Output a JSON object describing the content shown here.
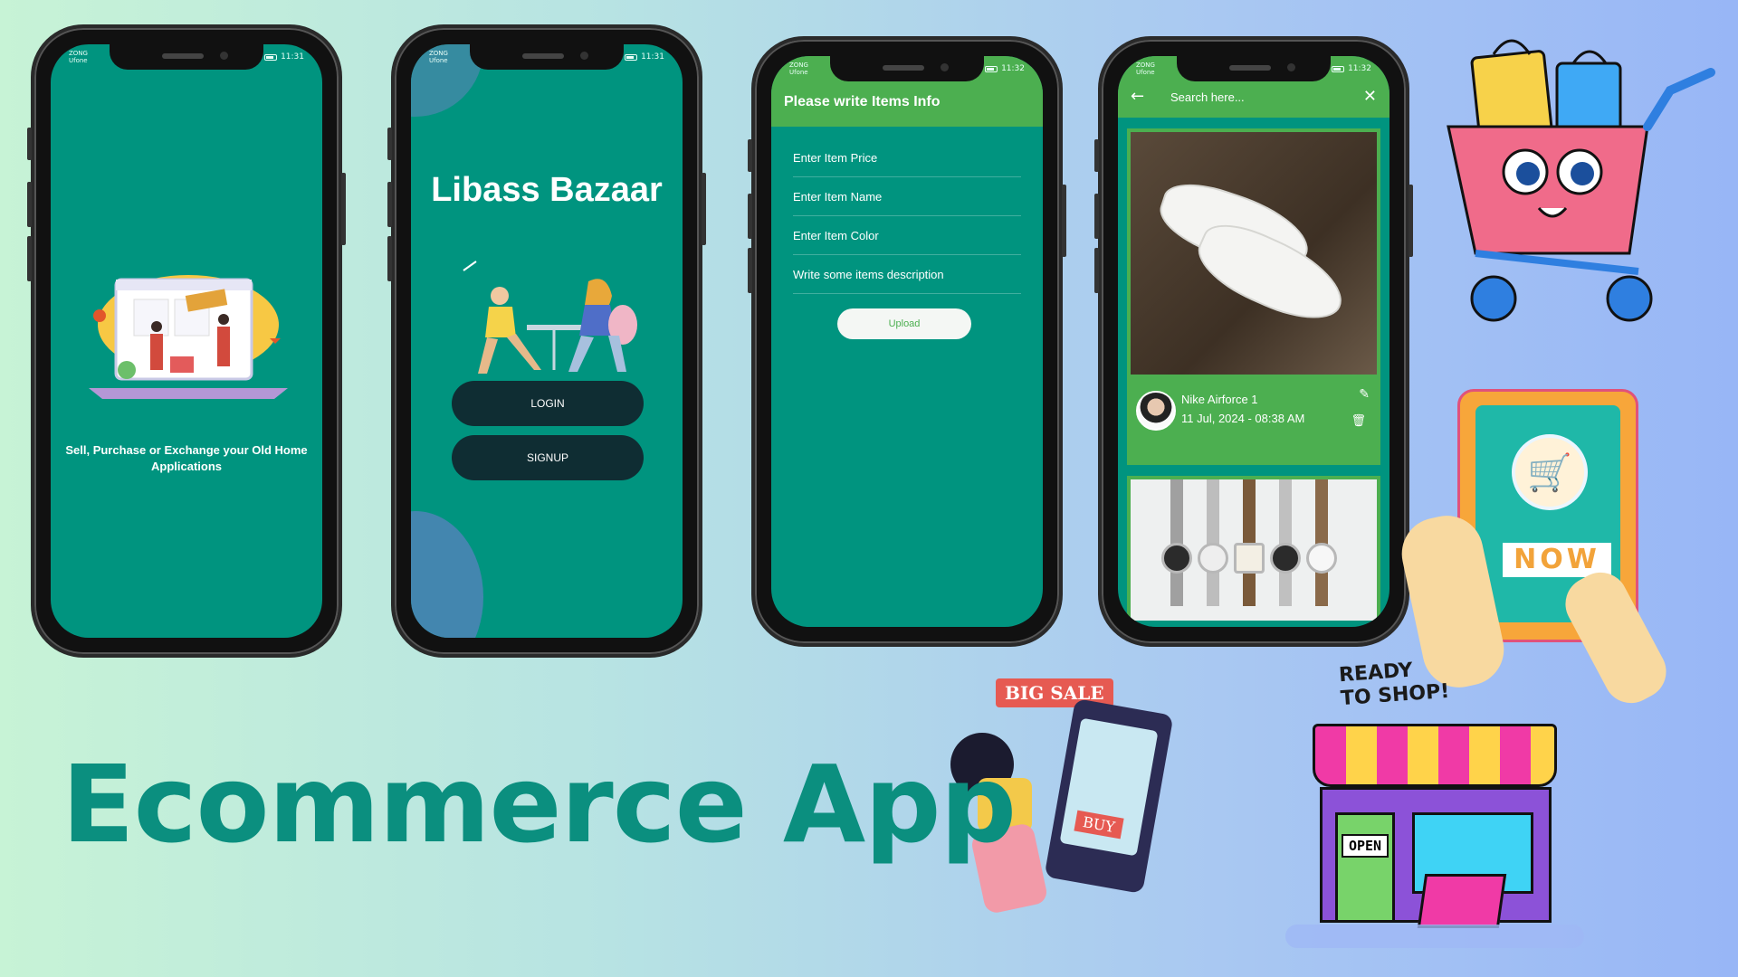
{
  "status_bar": {
    "carrier_1": "ZONG",
    "carrier_2": "Ufone",
    "time_a": "11:31",
    "time_b": "11:32"
  },
  "phone1": {
    "tagline": "Sell, Purchase or Exchange your Old Home Applications"
  },
  "phone2": {
    "app_title": "Libass Bazaar",
    "login_label": "LOGIN",
    "signup_label": "SIGNUP"
  },
  "phone3": {
    "header": "Please write Items Info",
    "fields": [
      "Enter Item Price",
      "Enter Item Name",
      "Enter Item Color",
      "Write some items description"
    ],
    "upload_label": "Upload"
  },
  "phone4": {
    "search_placeholder": "Search here...",
    "item_name": "Nike Airforce 1",
    "item_date": "11 Jul, 2024 - 08:38 AM"
  },
  "stickers": {
    "big_sale": "BIG SALE",
    "buy": "BUY",
    "now": "NOW",
    "ready_line1": "READY",
    "ready_line2": "TO SHOP!",
    "open": "OPEN"
  },
  "headline": "Ecommerce App",
  "colors": {
    "teal": "#00947f",
    "green": "#4caf50",
    "dark_button": "#0f2d33",
    "headline": "#0b8f7f"
  }
}
